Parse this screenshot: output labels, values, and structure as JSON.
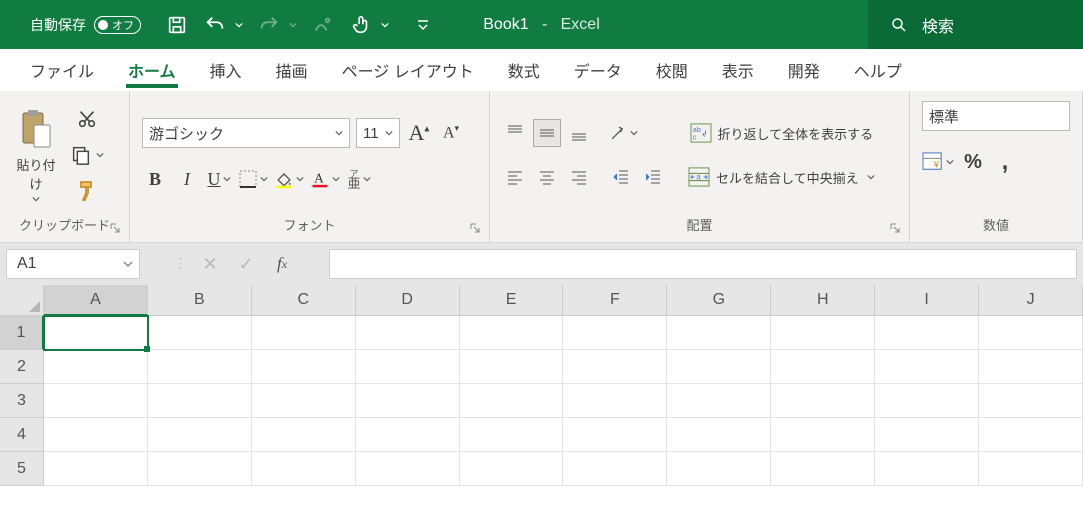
{
  "title": {
    "doc": "Book1",
    "sep": "-",
    "app": "Excel"
  },
  "autosave": {
    "label": "自動保存",
    "state": "オフ"
  },
  "search": {
    "placeholder": "検索"
  },
  "tabs": [
    "ファイル",
    "ホーム",
    "挿入",
    "描画",
    "ページ レイアウト",
    "数式",
    "データ",
    "校閲",
    "表示",
    "開発",
    "ヘルプ"
  ],
  "active_tab_index": 1,
  "ribbon": {
    "clipboard": {
      "paste": "貼り付け",
      "group": "クリップボード"
    },
    "font": {
      "name": "游ゴシック",
      "size": "11",
      "group": "フォント",
      "ruby": "ア\n亜"
    },
    "align": {
      "wrap": "折り返して全体を表示する",
      "merge": "セルを結合して中央揃え",
      "group": "配置"
    },
    "number": {
      "format": "標準",
      "group": "数値"
    }
  },
  "namebox": "A1",
  "columns": [
    "A",
    "B",
    "C",
    "D",
    "E",
    "F",
    "G",
    "H",
    "I",
    "J"
  ],
  "rows": [
    "1",
    "2",
    "3",
    "4",
    "5"
  ],
  "active_cell": {
    "row": 0,
    "col": 0
  }
}
